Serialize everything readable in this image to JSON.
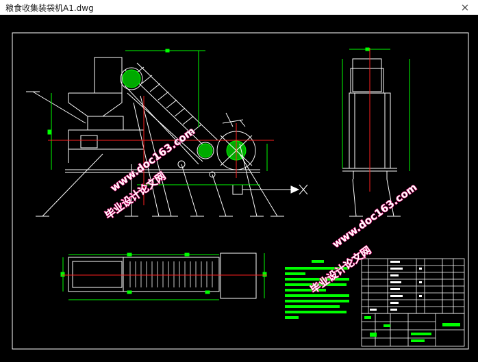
{
  "window": {
    "title": "粮食收集装袋机A1.dwg"
  },
  "watermarks": {
    "center_line1": "毕业设计论文网",
    "center_line2": "www.doc163.com",
    "right_line1": "毕业设计论文网",
    "right_line2": "www.doc163.com"
  },
  "colors": {
    "background": "#000000",
    "linework": "#ffffff",
    "dimension": "#00ff00",
    "centerline": "#ff2020",
    "watermark_fill": "#ffffff",
    "watermark_stroke": "#e0006e",
    "hatch": "#00ff00"
  }
}
